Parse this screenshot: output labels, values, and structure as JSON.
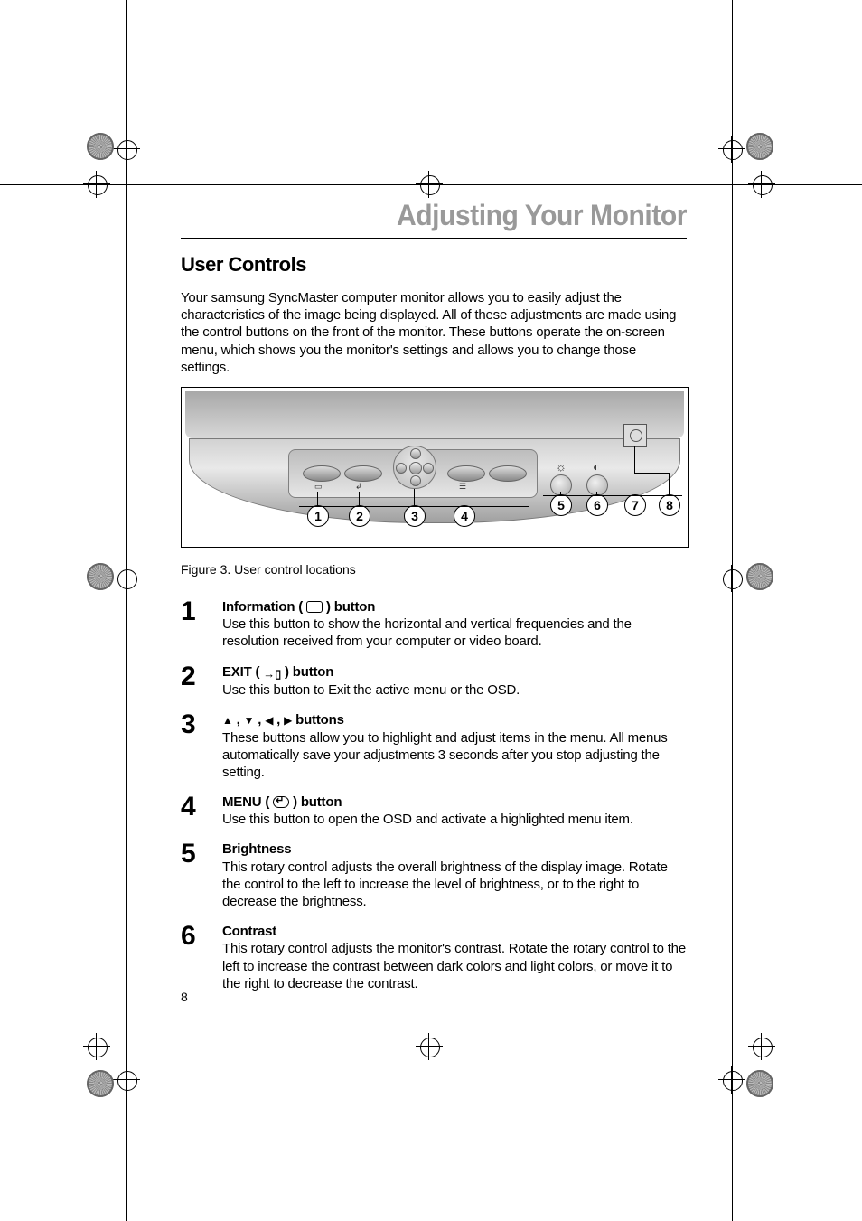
{
  "chapter_title": "Adjusting Your Monitor",
  "section_title": "User Controls",
  "intro": "Your samsung SyncMaster computer monitor allows you to easily adjust the characteristics of the image being displayed. All of these adjustments are made using the control buttons on the front of the monitor. These buttons operate the on-screen menu, which shows you the monitor's settings and allows you to change those settings.",
  "figure_caption": "Figure 3.  User control locations",
  "callouts": [
    "1",
    "2",
    "3",
    "4",
    "5",
    "6",
    "7",
    "8"
  ],
  "items": [
    {
      "num": "1",
      "title_pre": "Information ( ",
      "title_post": " ) button",
      "icon": "rect",
      "desc": "Use this button to show the horizontal and vertical frequencies and the resolution received from your computer or video board."
    },
    {
      "num": "2",
      "title_pre": "EXIT ( ",
      "title_post": " ) button",
      "icon": "exit",
      "desc": "Use this button to Exit the active menu or the OSD."
    },
    {
      "num": "3",
      "title_pre": "",
      "title_post": " buttons",
      "icon": "arrows",
      "desc": "These buttons allow you to highlight and adjust items in the menu. All menus automatically save your adjustments 3 seconds after you stop adjusting the setting."
    },
    {
      "num": "4",
      "title_pre": "MENU ( ",
      "title_post": " ) button",
      "icon": "menu",
      "desc": "Use this button to open the OSD and activate a highlighted menu item."
    },
    {
      "num": "5",
      "title_pre": "Brightness",
      "title_post": "",
      "icon": "",
      "desc": "This rotary control adjusts the overall brightness of the display image. Rotate the control to the left to increase the level of brightness, or to the right to decrease the brightness."
    },
    {
      "num": "6",
      "title_pre": "Contrast",
      "title_post": "",
      "icon": "",
      "desc": "This rotary control adjusts the monitor's contrast. Rotate the rotary control to the left to increase the contrast between dark colors and light colors, or move it to the right to decrease the contrast."
    }
  ],
  "page_number": "8"
}
